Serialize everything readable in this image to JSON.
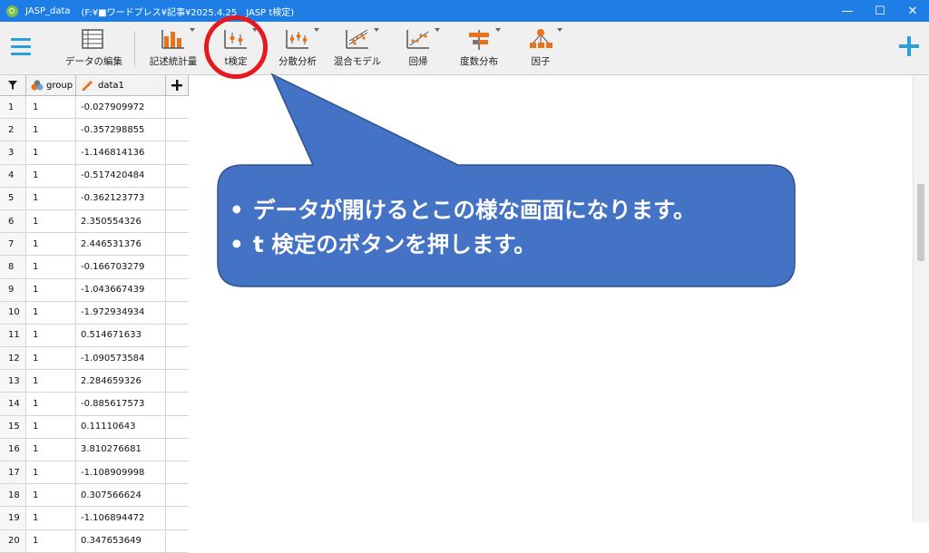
{
  "window": {
    "title": "JASP_data",
    "path": "(F:¥■ワードプレス¥記事¥2025.4.25　JASP t検定)",
    "controls": {
      "minimize": "—",
      "maximize": "☐",
      "close": "✕"
    }
  },
  "toolbar": {
    "items": [
      {
        "label": "データの編集",
        "icon": "table-icon"
      },
      {
        "label": "記述統計量",
        "icon": "bar-chart-icon"
      },
      {
        "label": "t検定",
        "icon": "t-test-icon"
      },
      {
        "label": "分散分析",
        "icon": "anova-icon"
      },
      {
        "label": "混合モデル",
        "icon": "mixed-model-icon"
      },
      {
        "label": "回帰",
        "icon": "regression-icon"
      },
      {
        "label": "度数分布",
        "icon": "frequencies-icon"
      },
      {
        "label": "因子",
        "icon": "factor-icon"
      }
    ]
  },
  "grid": {
    "columns": [
      "group",
      "data1"
    ],
    "rows": [
      {
        "n": "1",
        "group": "1",
        "data1": "-0.027909972"
      },
      {
        "n": "2",
        "group": "1",
        "data1": "-0.357298855"
      },
      {
        "n": "3",
        "group": "1",
        "data1": "-1.146814136"
      },
      {
        "n": "4",
        "group": "1",
        "data1": "-0.517420484"
      },
      {
        "n": "5",
        "group": "1",
        "data1": "-0.362123773"
      },
      {
        "n": "6",
        "group": "1",
        "data1": "2.350554326"
      },
      {
        "n": "7",
        "group": "1",
        "data1": "2.446531376"
      },
      {
        "n": "8",
        "group": "1",
        "data1": "-0.166703279"
      },
      {
        "n": "9",
        "group": "1",
        "data1": "-1.043667439"
      },
      {
        "n": "10",
        "group": "1",
        "data1": "-1.972934934"
      },
      {
        "n": "11",
        "group": "1",
        "data1": "0.514671633"
      },
      {
        "n": "12",
        "group": "1",
        "data1": "-1.090573584"
      },
      {
        "n": "13",
        "group": "1",
        "data1": "2.284659326"
      },
      {
        "n": "14",
        "group": "1",
        "data1": "-0.885617573"
      },
      {
        "n": "15",
        "group": "1",
        "data1": "0.11110643"
      },
      {
        "n": "16",
        "group": "1",
        "data1": "3.810276681"
      },
      {
        "n": "17",
        "group": "1",
        "data1": "-1.108909998"
      },
      {
        "n": "18",
        "group": "1",
        "data1": "0.307566624"
      },
      {
        "n": "19",
        "group": "1",
        "data1": "-1.106894472"
      },
      {
        "n": "20",
        "group": "1",
        "data1": "0.347653649"
      }
    ]
  },
  "callout": {
    "bullet": "•",
    "lines": [
      "データが開けるとこの様な画面になります。",
      "t 検定のボタンを押します。"
    ]
  },
  "colors": {
    "titlebar": "#1e7ee6",
    "accent": "#2b9fdc",
    "callout": "#4472c4",
    "highlight": "#e6191e",
    "icon_orange": "#e8731a"
  }
}
